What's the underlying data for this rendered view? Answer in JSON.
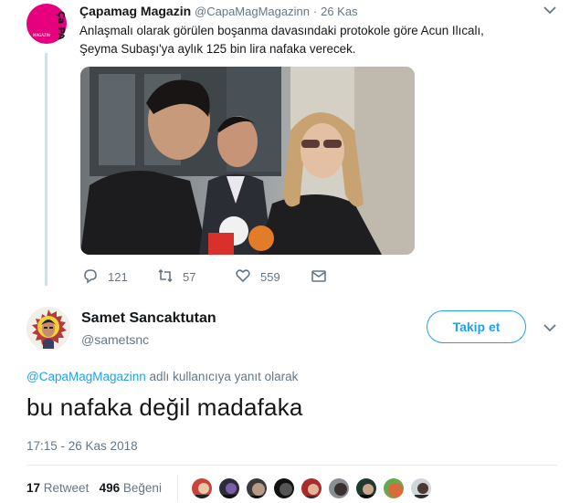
{
  "quoted_tweet": {
    "display_name": "Çapamag Magazin",
    "handle": "@CapaMagMagazinn",
    "separator": "·",
    "date": "26 Kas",
    "avatar_text": "Ça PA",
    "avatar_subtext": "MAGAZIN",
    "text_line1": "Anlaşmalı olarak görülen boşanma davasındaki protokole göre Acun Ilıcalı,",
    "text_line2": "Şeyma Subaşı'ya aylık 125 bin lira nafaka verecek.",
    "reply_count": "121",
    "retweet_count": "57",
    "like_count": "559"
  },
  "main_tweet": {
    "display_name": "Samet Sancaktutan",
    "handle": "@sametsnc",
    "follow_label": "Takip et",
    "reply_mention": "@CapaMagMagazinn",
    "reply_suffix": "adlı kullanıcıya yanıt olarak",
    "text": "bu nafaka değil madafaka",
    "timestamp": "17:15 - 26 Kas 2018",
    "retweet_count": "17",
    "retweet_label": "Retweet",
    "like_count": "496",
    "like_label": "Beğeni"
  },
  "colors": {
    "accent": "#1da1f2",
    "muted": "#657786",
    "thread_line": "#c4e3f3",
    "avatar_magenta": "#e6007e"
  },
  "icons": [
    "chevron-down-icon",
    "reply-icon",
    "retweet-icon",
    "heart-icon",
    "dm-envelope-icon"
  ]
}
